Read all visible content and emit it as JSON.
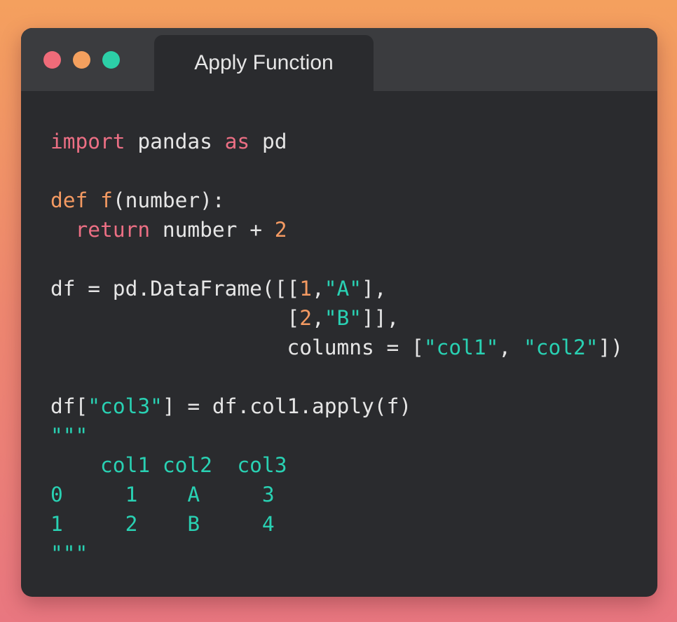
{
  "window": {
    "tab_title": "Apply Function"
  },
  "code_lines": [
    [
      {
        "t": "import",
        "c": "kw"
      },
      {
        "t": " pandas ",
        "c": "plain"
      },
      {
        "t": "as",
        "c": "kw"
      },
      {
        "t": " pd",
        "c": "plain"
      }
    ],
    [],
    [
      {
        "t": "def",
        "c": "fn"
      },
      {
        "t": " ",
        "c": "plain"
      },
      {
        "t": "f",
        "c": "fn"
      },
      {
        "t": "(number):",
        "c": "plain"
      }
    ],
    [
      {
        "t": "  ",
        "c": "plain"
      },
      {
        "t": "return",
        "c": "kw"
      },
      {
        "t": " number + ",
        "c": "plain"
      },
      {
        "t": "2",
        "c": "num"
      }
    ],
    [],
    [
      {
        "t": "df = pd.DataFrame([[",
        "c": "plain"
      },
      {
        "t": "1",
        "c": "num"
      },
      {
        "t": ",",
        "c": "plain"
      },
      {
        "t": "\"A\"",
        "c": "str"
      },
      {
        "t": "],",
        "c": "plain"
      }
    ],
    [
      {
        "t": "                   [",
        "c": "plain"
      },
      {
        "t": "2",
        "c": "num"
      },
      {
        "t": ",",
        "c": "plain"
      },
      {
        "t": "\"B\"",
        "c": "str"
      },
      {
        "t": "]],",
        "c": "plain"
      }
    ],
    [
      {
        "t": "                   columns = [",
        "c": "plain"
      },
      {
        "t": "\"col1\"",
        "c": "str"
      },
      {
        "t": ", ",
        "c": "plain"
      },
      {
        "t": "\"col2\"",
        "c": "str"
      },
      {
        "t": "])",
        "c": "plain"
      }
    ],
    [],
    [
      {
        "t": "df[",
        "c": "plain"
      },
      {
        "t": "\"col3\"",
        "c": "str"
      },
      {
        "t": "] = df.col1.apply(f)",
        "c": "plain"
      }
    ],
    [
      {
        "t": "\"\"\"",
        "c": "out"
      }
    ],
    [
      {
        "t": "    col1 col2  col3",
        "c": "out"
      }
    ],
    [
      {
        "t": "0     1    A     3",
        "c": "out"
      }
    ],
    [
      {
        "t": "1     2    B     4",
        "c": "out"
      }
    ],
    [
      {
        "t": "\"\"\"",
        "c": "out"
      }
    ]
  ]
}
